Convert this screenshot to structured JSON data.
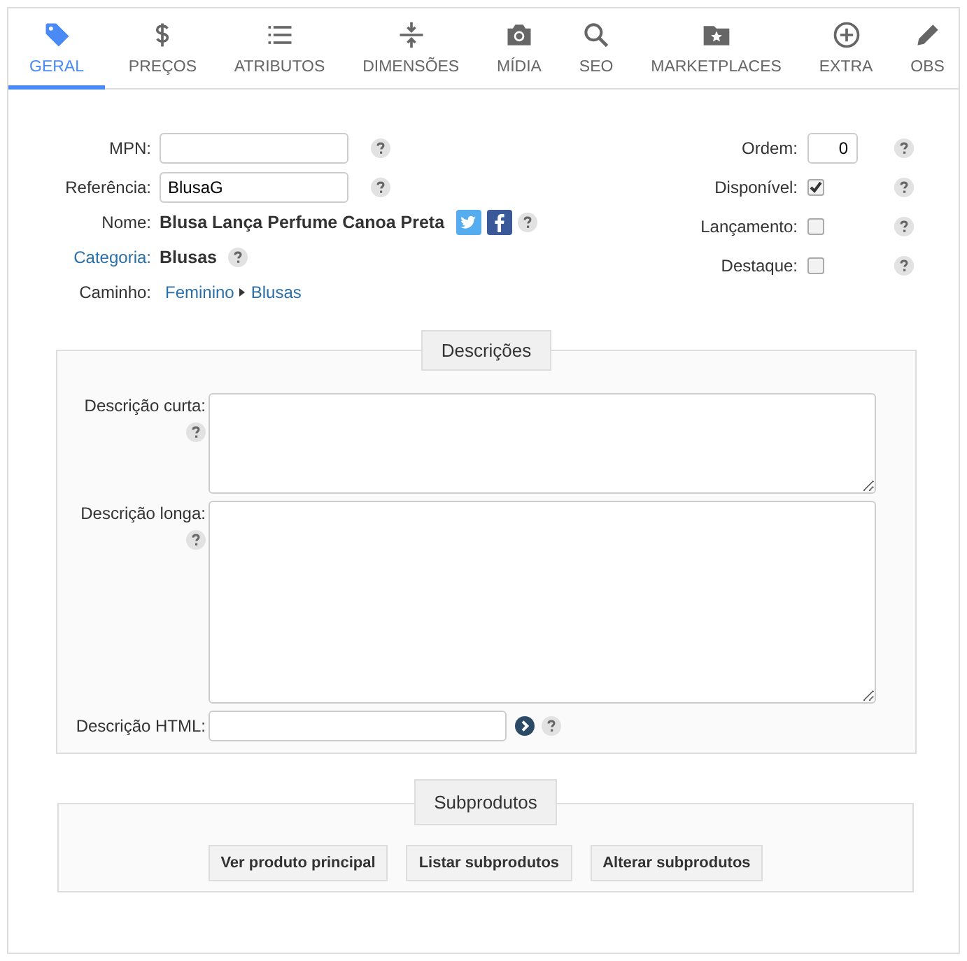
{
  "tabs": [
    {
      "label": "GERAL",
      "selected": true
    },
    {
      "label": "PREÇOS",
      "selected": false
    },
    {
      "label": "ATRIBUTOS",
      "selected": false
    },
    {
      "label": "DIMENSÕES",
      "selected": false
    },
    {
      "label": "MÍDIA",
      "selected": false
    },
    {
      "label": "SEO",
      "selected": false
    },
    {
      "label": "MARKETPLACES",
      "selected": false
    },
    {
      "label": "EXTRA",
      "selected": false
    },
    {
      "label": "OBS",
      "selected": false
    }
  ],
  "left_fields": [
    {
      "label": "MPN:",
      "kind": "input",
      "help": true
    },
    {
      "label": "Referência:",
      "kind": "input",
      "value": "BlusaG",
      "help": true
    },
    {
      "label": "Nome:",
      "kind": "text",
      "value": "Blusa Lança Perfume Canoa Preta",
      "share": true,
      "help": true
    },
    {
      "label": "Categoria:",
      "kind": "text",
      "label_link": true,
      "value": "Blusas",
      "help": true
    },
    {
      "label": "Caminho:",
      "kind": "path",
      "path": [
        "Feminino",
        "Blusas"
      ],
      "help": false
    }
  ],
  "right_fields": [
    {
      "label": "Ordem:",
      "kind": "number",
      "value": "0"
    },
    {
      "label": "Disponível:",
      "kind": "checkbox",
      "checked": true
    },
    {
      "label": "Lançamento:",
      "kind": "checkbox",
      "checked": false
    },
    {
      "label": "Destaque:",
      "kind": "checkbox",
      "checked": false
    }
  ],
  "descriptions": {
    "title": "Descrições",
    "fields": [
      {
        "label": "Descrição curta:",
        "kind": "short-area"
      },
      {
        "label": "Descrição longa:",
        "kind": "long-area"
      },
      {
        "label": "Descrição HTML:",
        "kind": "line"
      }
    ]
  },
  "subproducts": {
    "title": "Subprodutos",
    "buttons": [
      "Ver produto principal",
      "Listar subprodutos",
      "Alterar subprodutos"
    ]
  }
}
